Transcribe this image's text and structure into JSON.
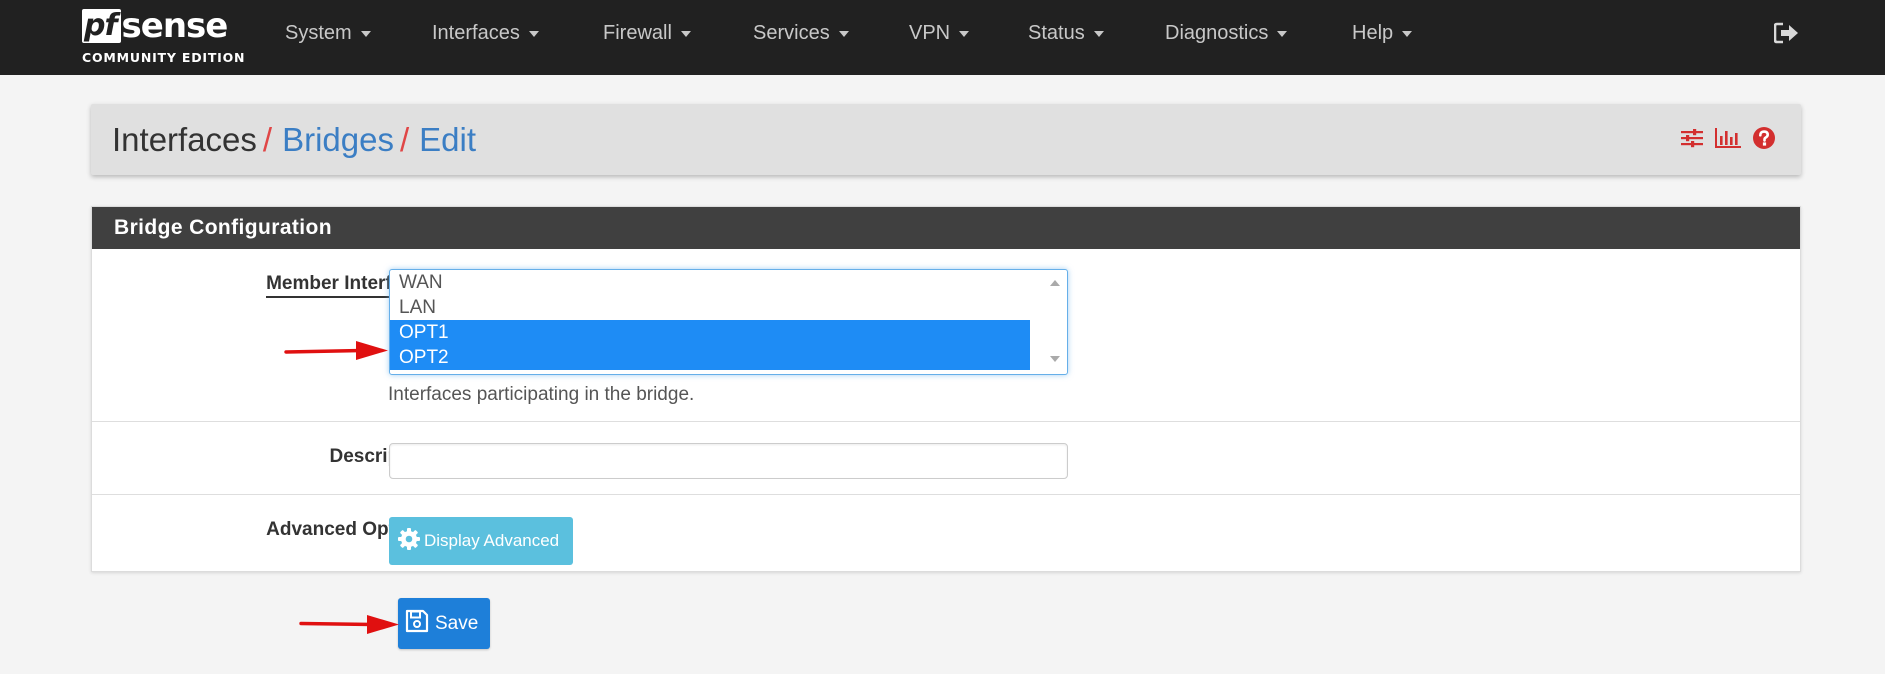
{
  "brand": {
    "logo_prefix": "pf",
    "logo_main": "sense",
    "edition": "COMMUNITY EDITION"
  },
  "nav": {
    "items": [
      {
        "label": "System"
      },
      {
        "label": "Interfaces"
      },
      {
        "label": "Firewall"
      },
      {
        "label": "Services"
      },
      {
        "label": "VPN"
      },
      {
        "label": "Status"
      },
      {
        "label": "Diagnostics"
      },
      {
        "label": "Help"
      }
    ],
    "logout_icon": "sign-out-icon"
  },
  "breadcrumb": {
    "root": "Interfaces",
    "sep": "/",
    "bridges": "Bridges",
    "edit": "Edit"
  },
  "header_icons": [
    "sliders-icon",
    "bar-chart-icon",
    "help-circle-icon"
  ],
  "panel": {
    "title": "Bridge Configuration",
    "member_interfaces": {
      "label": "Member Interfaces",
      "options": [
        {
          "label": "WAN",
          "selected": false
        },
        {
          "label": "LAN",
          "selected": false
        },
        {
          "label": "OPT1",
          "selected": true
        },
        {
          "label": "OPT2",
          "selected": true
        }
      ],
      "help": "Interfaces participating in the bridge."
    },
    "description": {
      "label": "Description",
      "value": ""
    },
    "advanced": {
      "label": "Advanced Options",
      "button": "Display Advanced"
    }
  },
  "save_button": "Save",
  "colors": {
    "navbar": "#212121",
    "accent_red": "#e04646",
    "link_blue": "#3b7ec4",
    "selected_option": "#1e8cf5",
    "info_button": "#5bc0de",
    "primary_button": "#1e7fd9",
    "annotation_arrow": "#e01010"
  }
}
